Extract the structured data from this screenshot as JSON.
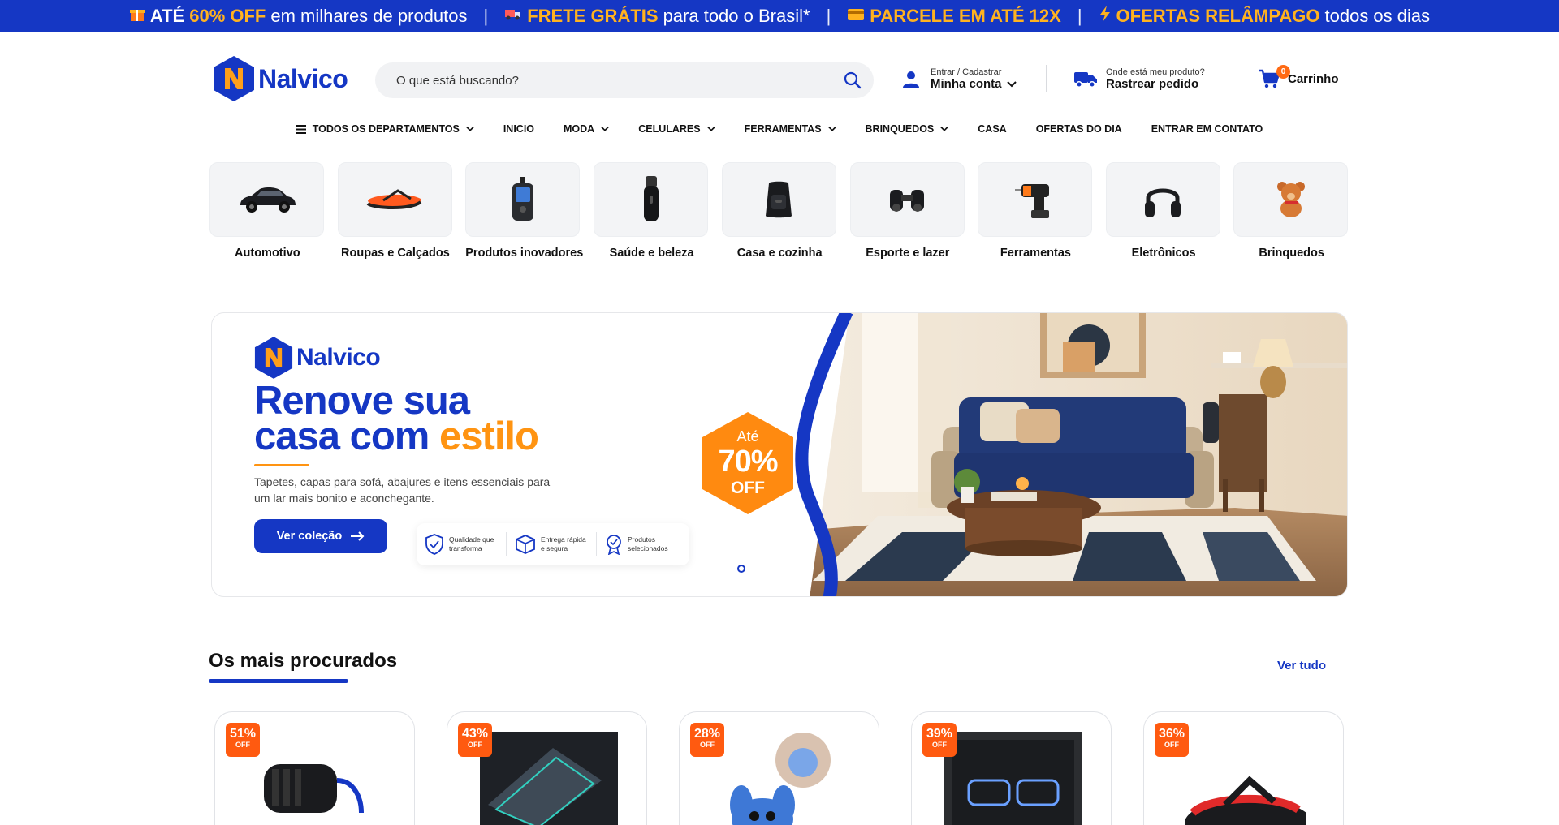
{
  "promo": {
    "p1_pre": "ATÉ",
    "p1_hl": "60% OFF",
    "p1_post": "em milhares de produtos",
    "p2_hl": "FRETE GRÁTIS",
    "p2_post": "para todo o Brasil*",
    "p3_hl": "PARCELE EM ATÉ 12X",
    "p4_hl": "OFERTAS RELÂMPAGO",
    "p4_post": "todos os dias",
    "separator": "|"
  },
  "header": {
    "logo_text": "Nalvico",
    "search_placeholder": "O que está buscando?",
    "account_small": "Entrar / Cadastrar",
    "account_big": "Minha conta",
    "track_small": "Onde está meu produto?",
    "track_big": "Rastrear pedido",
    "cart_label": "Carrinho",
    "cart_count": "0"
  },
  "nav": {
    "all": "TODOS OS DEPARTAMENTOS",
    "inicio": "INICIO",
    "moda": "MODA",
    "celulares": "CELULARES",
    "ferramentas": "FERRAMENTAS",
    "brinquedos": "BRINQUEDOS",
    "casa": "CASA",
    "ofertas": "OFERTAS DO DIA",
    "contato": "ENTRAR EM CONTATO"
  },
  "categories": [
    {
      "name": "Automotivo",
      "icon": "car-icon"
    },
    {
      "name": "Roupas e Calçados",
      "icon": "sandal-icon"
    },
    {
      "name": "Produtos inovadores",
      "icon": "gps-device-icon"
    },
    {
      "name": "Saúde e beleza",
      "icon": "shaver-icon"
    },
    {
      "name": "Casa e cozinha",
      "icon": "air-fryer-icon"
    },
    {
      "name": "Esporte e lazer",
      "icon": "binoculars-icon"
    },
    {
      "name": "Ferramentas",
      "icon": "drill-icon"
    },
    {
      "name": "Eletrônicos",
      "icon": "headphones-icon"
    },
    {
      "name": "Brinquedos",
      "icon": "teddy-bear-icon"
    }
  ],
  "banner": {
    "logo_text": "Nalvico",
    "title_line1": "Renove sua",
    "title_line2_a": "casa com",
    "title_line2_b": "estilo",
    "description": "Tapetes, capas para sofá, abajures e itens essenciais para um lar mais bonito e aconchegante.",
    "button": "Ver coleção",
    "feat1": "Qualidade que transforma",
    "feat2": "Entrega rápida e segura",
    "feat3": "Produtos selecionados",
    "badge_top": "Até",
    "badge_pct": "70%",
    "badge_off": "OFF",
    "colors": {
      "blue": "#1537c4",
      "orange": "#ff9412"
    }
  },
  "section": {
    "title": "Os mais procurados",
    "see_all": "Ver tudo"
  },
  "products": [
    {
      "discount": "51%",
      "off": "OFF"
    },
    {
      "discount": "43%",
      "off": "OFF"
    },
    {
      "discount": "28%",
      "off": "OFF"
    },
    {
      "discount": "39%",
      "off": "OFF"
    },
    {
      "discount": "36%",
      "off": "OFF"
    }
  ]
}
